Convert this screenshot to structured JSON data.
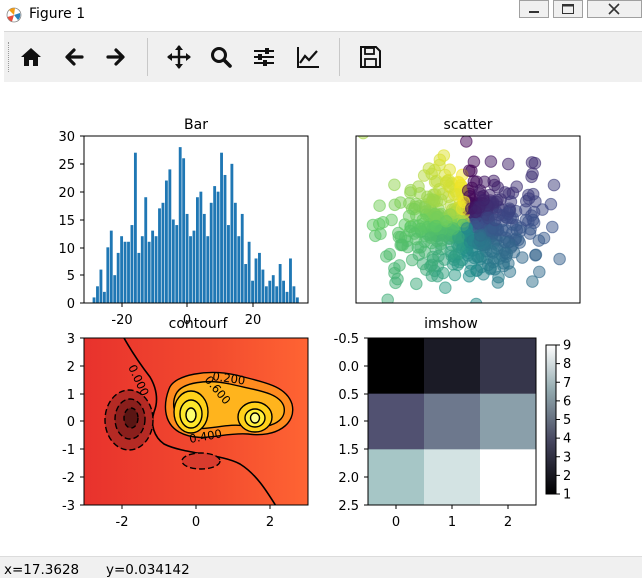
{
  "window": {
    "title": "Figure 1"
  },
  "toolbar": {
    "buttons": [
      {
        "name": "home",
        "icon": "home-icon"
      },
      {
        "name": "back",
        "icon": "arrow-left-icon"
      },
      {
        "name": "forward",
        "icon": "arrow-right-icon"
      },
      {
        "name": "pan",
        "icon": "move-icon"
      },
      {
        "name": "zoom",
        "icon": "magnifier-icon"
      },
      {
        "name": "configure-subplots",
        "icon": "sliders-icon"
      },
      {
        "name": "edit-axes",
        "icon": "line-chart-icon"
      },
      {
        "name": "save",
        "icon": "floppy-disk-icon"
      }
    ]
  },
  "status": {
    "x": "x=17.3628",
    "y": "y=0.034142"
  },
  "chart_data": [
    {
      "type": "bar",
      "title": "Bar",
      "xlim": [
        -30,
        35
      ],
      "ylim": [
        0,
        30
      ],
      "xticks": [
        "-20",
        "0",
        "20"
      ],
      "yticks": [
        "0",
        "5",
        "10",
        "15",
        "20",
        "25",
        "30"
      ],
      "bar_color": "#1f77b4",
      "x": [
        -27,
        -26,
        -25,
        -24,
        -23,
        -22,
        -21,
        -20,
        -19,
        -18,
        -17,
        -16,
        -15,
        -14,
        -13,
        -12,
        -11,
        -10,
        -9,
        -8,
        -7,
        -6,
        -5,
        -4,
        -3,
        -2,
        -1,
        0,
        1,
        2,
        3,
        4,
        5,
        6,
        7,
        8,
        9,
        10,
        11,
        12,
        13,
        14,
        15,
        16,
        17,
        18,
        19,
        20,
        21,
        22,
        23,
        24,
        25,
        26,
        27,
        28,
        29,
        30,
        31,
        32
      ],
      "values": [
        1,
        3,
        6,
        2,
        10,
        13,
        5,
        9,
        12,
        11,
        11,
        14,
        27,
        9,
        12,
        19,
        11,
        13,
        12,
        17,
        18,
        22,
        24,
        15,
        14,
        28,
        26,
        16,
        12,
        13,
        19,
        20,
        16,
        12,
        18,
        21,
        20,
        27,
        23,
        14,
        25,
        18,
        12,
        16,
        7,
        11,
        4,
        8,
        9,
        6,
        3,
        4,
        5,
        3,
        7,
        4,
        2,
        8,
        3,
        1
      ]
    },
    {
      "type": "scatter",
      "title": "scatter",
      "colormap": "viridis",
      "alpha": 0.5,
      "axes_ticks": "hidden"
    },
    {
      "type": "heatmap",
      "title": "contourf",
      "xlim": [
        -3,
        3
      ],
      "ylim": [
        -3,
        3
      ],
      "xticks": [
        "-2",
        "0",
        "2"
      ],
      "yticks": [
        "3",
        "2",
        "1",
        "0",
        "-1",
        "-2",
        "-3"
      ],
      "contour_labels": [
        "0.000",
        "0.200",
        "0.600",
        "0.400"
      ],
      "colormap": "hot"
    },
    {
      "type": "heatmap",
      "title": "imshow",
      "values": [
        [
          1,
          2,
          3
        ],
        [
          4,
          5,
          6
        ],
        [
          7,
          8,
          9
        ]
      ],
      "colormap": "bone",
      "xticks": [
        "0",
        "1",
        "2"
      ],
      "yticks": [
        "-0.5",
        "0.0",
        "0.5",
        "1.0",
        "1.5",
        "2.0",
        "2.5"
      ],
      "colorbar_ticks": [
        "9",
        "8",
        "7",
        "6",
        "5",
        "4",
        "3",
        "2",
        "1"
      ],
      "clim": [
        1,
        9
      ]
    }
  ]
}
